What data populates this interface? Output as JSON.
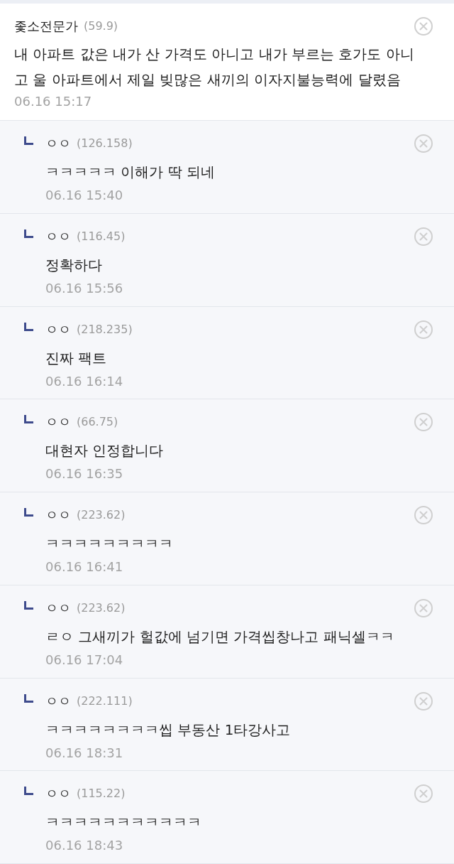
{
  "comment": {
    "author": "좇소전문가",
    "ip": "(59.9)",
    "text": "내 아파트 값은 내가 산 가격도 아니고 내가 부르는 호가도 아니고 울 아파트에서 제일 빚많은 새끼의 이자지불능력에 달렸음",
    "date": "06.16 15:17"
  },
  "replies": [
    {
      "author": "ㅇㅇ",
      "ip": "(126.158)",
      "text": "ㅋㅋㅋㅋㅋ 이해가 딱 되네",
      "date": "06.16 15:40"
    },
    {
      "author": "ㅇㅇ",
      "ip": "(116.45)",
      "text": "정확하다",
      "date": "06.16 15:56"
    },
    {
      "author": "ㅇㅇ",
      "ip": "(218.235)",
      "text": "진짜 팩트",
      "date": "06.16 16:14"
    },
    {
      "author": "ㅇㅇ",
      "ip": "(66.75)",
      "text": "대현자 인정합니다",
      "date": "06.16 16:35"
    },
    {
      "author": "ㅇㅇ",
      "ip": "(223.62)",
      "text": "ㅋㅋㅋㅋㅋㅋㅋㅋㅋ",
      "date": "06.16 16:41"
    },
    {
      "author": "ㅇㅇ",
      "ip": "(223.62)",
      "text": "ㄹㅇ 그새끼가 헐값에 넘기면 가격씹창나고 패닉셀ㅋㅋ",
      "date": "06.16 17:04"
    },
    {
      "author": "ㅇㅇ",
      "ip": "(222.111)",
      "text": "ㅋㅋㅋㅋㅋㅋㅋㅋ씹 부동산 1타강사고",
      "date": "06.16 18:31"
    },
    {
      "author": "ㅇㅇ",
      "ip": "(115.22)",
      "text": "ㅋㅋㅋㅋㅋㅋㅋㅋㅋㅋㅋ",
      "date": "06.16 18:43"
    }
  ]
}
